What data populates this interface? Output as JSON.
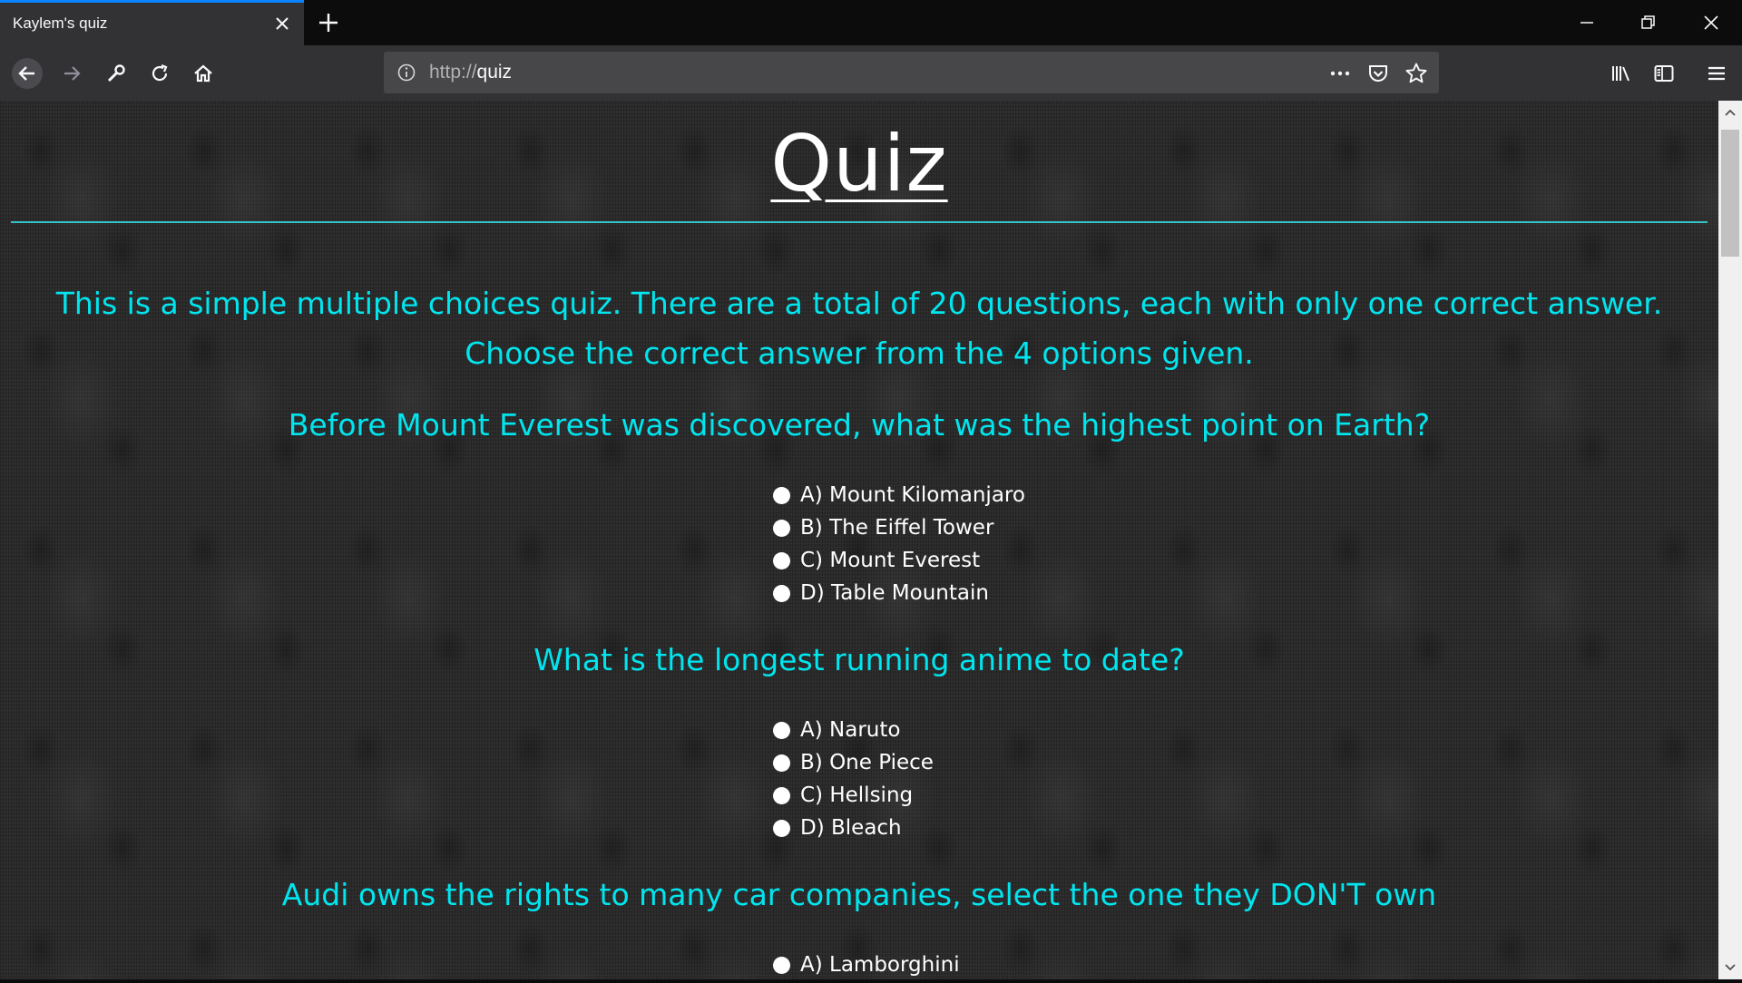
{
  "browser": {
    "tab_title": "Kaylem's quiz",
    "url_scheme": "http://",
    "url_host": "quiz"
  },
  "page": {
    "title": "Quiz",
    "intro": "This is a simple multiple choices quiz. There are a total of 20 questions, each with only one correct answer. Choose the correct answer from the 4 options given.",
    "questions": [
      {
        "text": "Before Mount Everest was discovered, what was the highest point on Earth?",
        "options": [
          "A) Mount Kilomanjaro",
          "B) The Eiffel Tower",
          "C) Mount Everest",
          "D) Table Mountain"
        ]
      },
      {
        "text": "What is the longest running anime to date?",
        "options": [
          "A) Naruto",
          "B) One Piece",
          "C) Hellsing",
          "D) Bleach"
        ]
      },
      {
        "text": "Audi owns the rights to many car companies, select the one they DON'T own",
        "options": [
          "A) Lamborghini"
        ]
      }
    ]
  },
  "colors": {
    "accent": "#00e5ee",
    "rule": "#33c4c8",
    "tab_highlight": "#0a84ff"
  },
  "icons": [
    "close-icon",
    "plus-icon",
    "minimize-icon",
    "restore-icon",
    "window-close-icon",
    "back-arrow-icon",
    "forward-arrow-icon",
    "wrench-icon",
    "reload-icon",
    "home-icon",
    "info-icon",
    "more-icon",
    "pocket-icon",
    "star-icon",
    "library-icon",
    "sidebar-icon",
    "menu-icon"
  ]
}
